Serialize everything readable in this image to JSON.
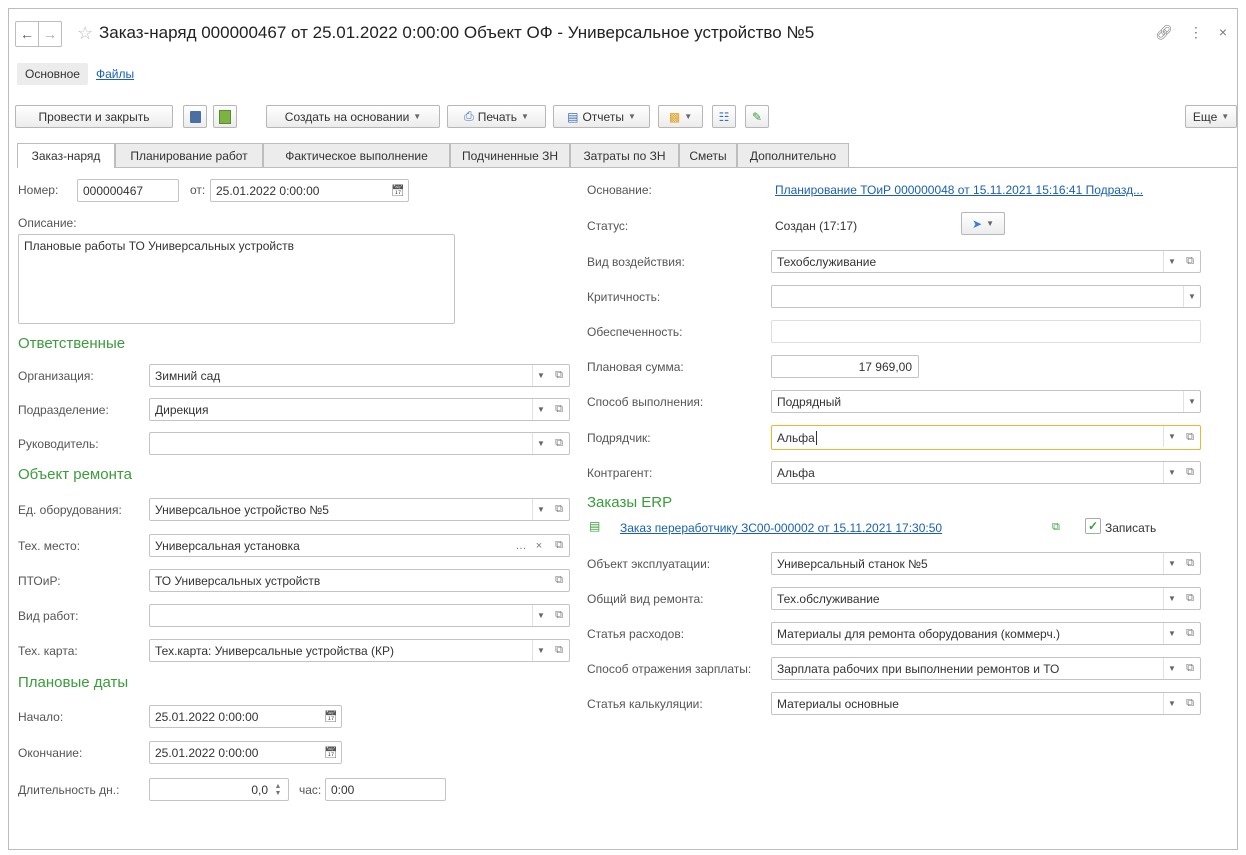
{
  "window": {
    "title": "Заказ-наряд 000000467 от 25.01.2022 0:00:00 Объект ОФ - Универсальное устройство №5"
  },
  "sections": {
    "main": "Основное",
    "files": "Файлы"
  },
  "toolbar": {
    "post_close": "Провести и закрыть",
    "create_based": "Создать на основании",
    "print": "Печать",
    "reports": "Отчеты",
    "more": "Еще"
  },
  "tabs": [
    "Заказ-наряд",
    "Планирование работ",
    "Фактическое выполнение",
    "Подчиненные ЗН",
    "Затраты по ЗН",
    "Сметы",
    "Дополнительно"
  ],
  "left": {
    "number_label": "Номер:",
    "number": "000000467",
    "from_label": "от:",
    "date": "25.01.2022  0:00:00",
    "description_label": "Описание:",
    "description": "Плановые работы ТО Универсальных устройств",
    "responsible_title": "Ответственные",
    "org_label": "Организация:",
    "org": "Зимний сад",
    "dept_label": "Подразделение:",
    "dept": "Дирекция",
    "manager_label": "Руководитель:",
    "manager": "",
    "repair_title": "Объект ремонта",
    "equip_label": "Ед. оборудования:",
    "equip": "Универсальное устройство №5",
    "place_label": "Тех. место:",
    "place": "Универсальная установка",
    "ptoir_label": "ПТОиР:",
    "ptoir": "ТО Универсальных устройств",
    "work_type_label": "Вид работ:",
    "work_type": "",
    "tech_card_label": "Тех. карта:",
    "tech_card": "Тех.карта: Универсальные устройства (КР)",
    "dates_title": "Плановые даты",
    "start_label": "Начало:",
    "start": "25.01.2022  0:00:00",
    "end_label": "Окончание:",
    "end": "25.01.2022  0:00:00",
    "duration_label": "Длительность  дн.:",
    "duration_days": "0,0",
    "hours_label": "час:",
    "duration_hours": "0:00"
  },
  "right": {
    "basis_label": "Основание:",
    "basis": "Планирование ТОиР 000000048 от 15.11.2021 15:16:41 Подразд...",
    "status_label": "Статус:",
    "status": "Создан (17:17)",
    "impact_label": "Вид воздействия:",
    "impact": "Техобслуживание",
    "criticality_label": "Критичность:",
    "criticality": "",
    "provision_label": "Обеспеченность:",
    "provision": "",
    "planned_sum_label": "Плановая сумма:",
    "planned_sum": "17 969,00",
    "method_label": "Способ выполнения:",
    "method": "Подрядный",
    "contractor_label": "Подрядчик:",
    "contractor": "Альфа",
    "counterparty_label": "Контрагент:",
    "counterparty": "Альфа",
    "erp_title": "Заказы ERP",
    "erp_order": "Заказ переработчику ЗС00-000002 от 15.11.2021 17:30:50",
    "write_label": "Записать",
    "object_label": "Объект эксплуатации:",
    "object": "Универсальный станок №5",
    "repair_kind_label": "Общий вид ремонта:",
    "repair_kind": "Тех.обслуживание",
    "expense_label": "Статья расходов:",
    "expense": "Материалы для ремонта оборудования (коммерч.)",
    "salary_label": "Способ отражения зарплаты:",
    "salary": "Зарплата рабочих при выполнении ремонтов и ТО",
    "calc_label": "Статья калькуляции:",
    "calc": "Материалы основные"
  }
}
